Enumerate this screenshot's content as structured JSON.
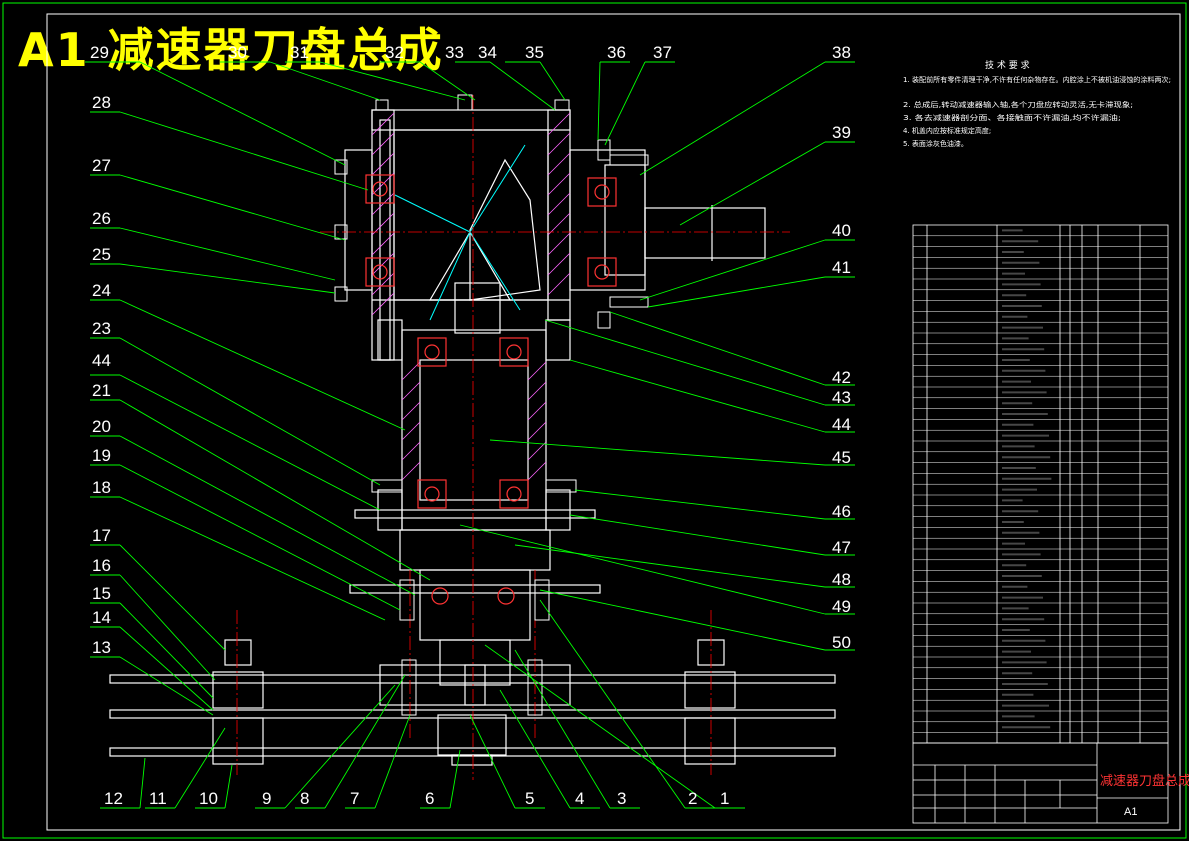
{
  "title": "A1 减速器刀盘总成",
  "part_labels_top": [
    "29",
    "30",
    "31",
    "32",
    "33",
    "34",
    "35",
    "36",
    "37",
    "38",
    "39"
  ],
  "part_labels_left": [
    "28",
    "27",
    "26",
    "25",
    "24",
    "23",
    "44",
    "21",
    "20",
    "19",
    "18",
    "17",
    "16",
    "15",
    "14",
    "13"
  ],
  "part_labels_right": [
    "40",
    "41",
    "42",
    "43",
    "44",
    "45",
    "46",
    "47",
    "48",
    "49",
    "50"
  ],
  "part_labels_bottom": [
    "12",
    "11",
    "10",
    "9",
    "8",
    "7",
    "6",
    "5",
    "4",
    "3",
    "2",
    "1"
  ],
  "tech_requirements": {
    "heading": "技 术 要 求",
    "items": [
      "1. 装配前所有零件清理干净,不许有任何杂物存在。内腔涂上不被机油浸蚀的涂料两次;",
      "2. 总成后,转动减速器输入轴,各个刀盘应转动灵活,无卡滞现象;",
      "3. 各去减速器剖分面、各接触面不许漏油,均不许漏油;",
      "4. 机盖内应按标准规定高度;",
      "5. 表面涂灰色油漆。"
    ]
  },
  "title_block": {
    "drawing_name": "减速器刀盘总成",
    "sheet_size": "A1"
  },
  "colors": {
    "outline": "#ffffff",
    "leader": "#00ff00",
    "center": "#ff0000",
    "hatch": "#ff00ff",
    "bearing": "#ff3333",
    "shaft": "#00ffff",
    "banner": "#ffff00"
  }
}
